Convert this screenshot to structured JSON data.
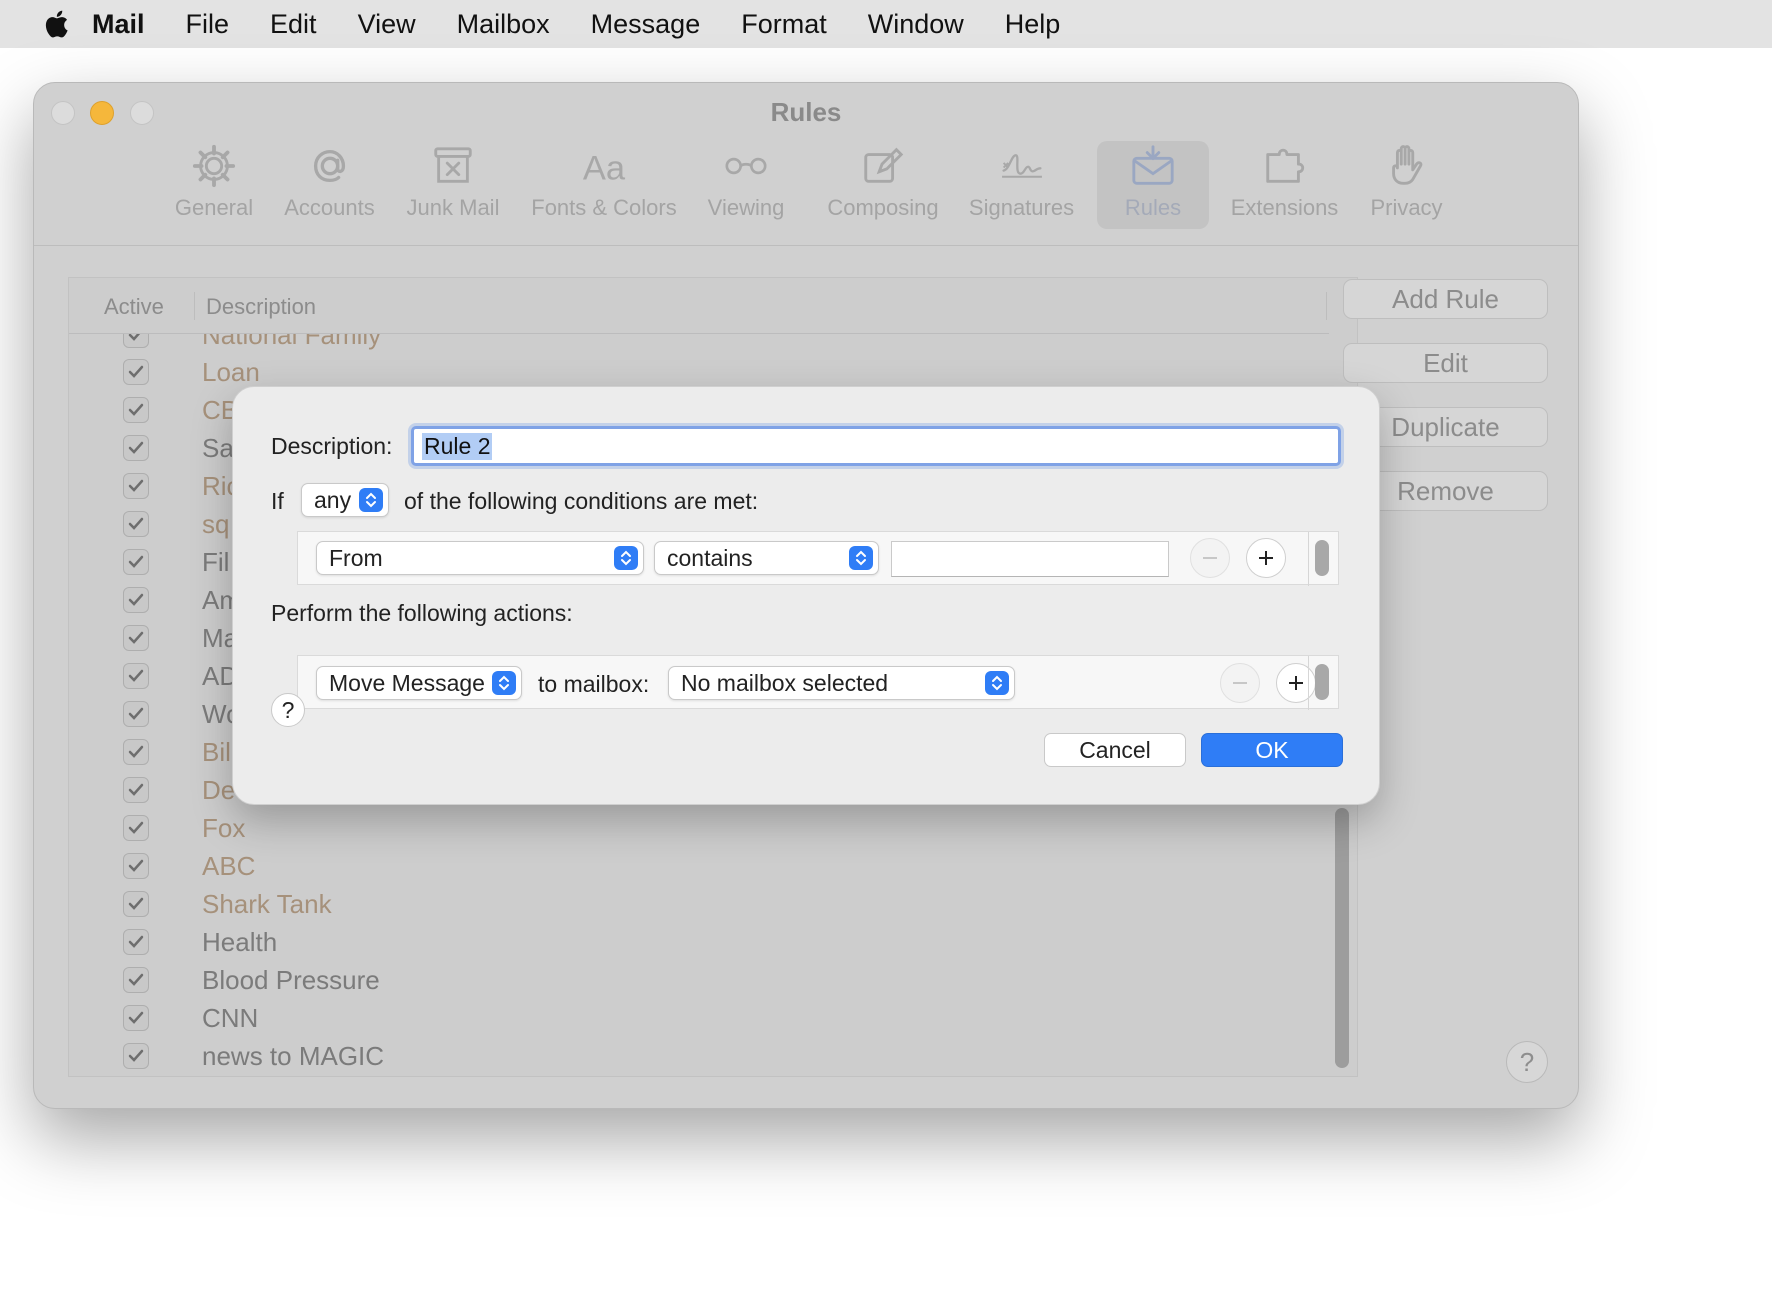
{
  "menubar": {
    "items": [
      "Mail",
      "File",
      "Edit",
      "View",
      "Mailbox",
      "Message",
      "Format",
      "Window",
      "Help"
    ]
  },
  "window": {
    "title": "Rules",
    "toolbar": {
      "general": "General",
      "accounts": "Accounts",
      "junk": "Junk Mail",
      "fonts": "Fonts & Colors",
      "viewing": "Viewing",
      "composing": "Composing",
      "signatures": "Signatures",
      "rules": "Rules",
      "extensions": "Extensions",
      "privacy": "Privacy"
    },
    "table": {
      "col_active": "Active",
      "col_description": "Description",
      "rules": [
        "National Family",
        "Loan",
        "CB",
        "Sa",
        "Ric",
        "sq",
        "Fil",
        "Am",
        "Ma",
        "AD",
        "Wo",
        "Bil",
        "De",
        "Fox",
        "ABC",
        "Shark Tank",
        "Health",
        "Blood Pressure",
        "CNN",
        "news to MAGIC"
      ]
    },
    "buttons": {
      "add_rule": "Add Rule",
      "edit": "Edit",
      "duplicate": "Duplicate",
      "remove": "Remove",
      "help": "?"
    }
  },
  "sheet": {
    "description_label": "Description:",
    "description_value": "Rule 2",
    "if_label": "If",
    "match_value": "any",
    "conditions_suffix": "of the following conditions are met:",
    "condition_field": "From",
    "condition_operator": "contains",
    "condition_value": "",
    "actions_label": "Perform the following actions:",
    "action_type": "Move Message",
    "to_mailbox_label": "to mailbox:",
    "mailbox_value": "No mailbox selected",
    "help": "?",
    "cancel": "Cancel",
    "ok": "OK"
  },
  "colors": {
    "accent": "#2f7df6",
    "rule_brown": "#a6917b"
  }
}
